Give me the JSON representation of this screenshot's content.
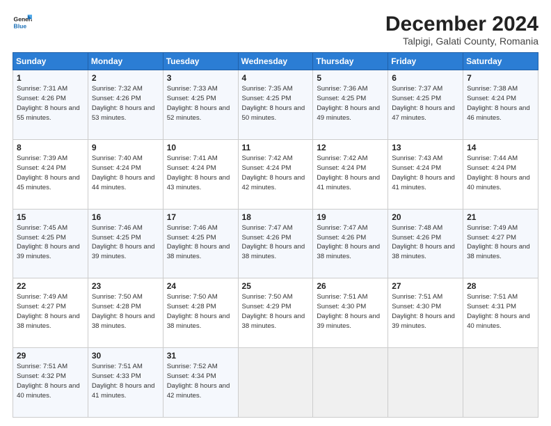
{
  "logo": {
    "line1": "General",
    "line2": "Blue"
  },
  "title": "December 2024",
  "subtitle": "Talpigi, Galati County, Romania",
  "header_days": [
    "Sunday",
    "Monday",
    "Tuesday",
    "Wednesday",
    "Thursday",
    "Friday",
    "Saturday"
  ],
  "weeks": [
    [
      {
        "day": "1",
        "sunrise": "Sunrise: 7:31 AM",
        "sunset": "Sunset: 4:26 PM",
        "daylight": "Daylight: 8 hours and 55 minutes."
      },
      {
        "day": "2",
        "sunrise": "Sunrise: 7:32 AM",
        "sunset": "Sunset: 4:26 PM",
        "daylight": "Daylight: 8 hours and 53 minutes."
      },
      {
        "day": "3",
        "sunrise": "Sunrise: 7:33 AM",
        "sunset": "Sunset: 4:25 PM",
        "daylight": "Daylight: 8 hours and 52 minutes."
      },
      {
        "day": "4",
        "sunrise": "Sunrise: 7:35 AM",
        "sunset": "Sunset: 4:25 PM",
        "daylight": "Daylight: 8 hours and 50 minutes."
      },
      {
        "day": "5",
        "sunrise": "Sunrise: 7:36 AM",
        "sunset": "Sunset: 4:25 PM",
        "daylight": "Daylight: 8 hours and 49 minutes."
      },
      {
        "day": "6",
        "sunrise": "Sunrise: 7:37 AM",
        "sunset": "Sunset: 4:25 PM",
        "daylight": "Daylight: 8 hours and 47 minutes."
      },
      {
        "day": "7",
        "sunrise": "Sunrise: 7:38 AM",
        "sunset": "Sunset: 4:24 PM",
        "daylight": "Daylight: 8 hours and 46 minutes."
      }
    ],
    [
      {
        "day": "8",
        "sunrise": "Sunrise: 7:39 AM",
        "sunset": "Sunset: 4:24 PM",
        "daylight": "Daylight: 8 hours and 45 minutes."
      },
      {
        "day": "9",
        "sunrise": "Sunrise: 7:40 AM",
        "sunset": "Sunset: 4:24 PM",
        "daylight": "Daylight: 8 hours and 44 minutes."
      },
      {
        "day": "10",
        "sunrise": "Sunrise: 7:41 AM",
        "sunset": "Sunset: 4:24 PM",
        "daylight": "Daylight: 8 hours and 43 minutes."
      },
      {
        "day": "11",
        "sunrise": "Sunrise: 7:42 AM",
        "sunset": "Sunset: 4:24 PM",
        "daylight": "Daylight: 8 hours and 42 minutes."
      },
      {
        "day": "12",
        "sunrise": "Sunrise: 7:42 AM",
        "sunset": "Sunset: 4:24 PM",
        "daylight": "Daylight: 8 hours and 41 minutes."
      },
      {
        "day": "13",
        "sunrise": "Sunrise: 7:43 AM",
        "sunset": "Sunset: 4:24 PM",
        "daylight": "Daylight: 8 hours and 41 minutes."
      },
      {
        "day": "14",
        "sunrise": "Sunrise: 7:44 AM",
        "sunset": "Sunset: 4:24 PM",
        "daylight": "Daylight: 8 hours and 40 minutes."
      }
    ],
    [
      {
        "day": "15",
        "sunrise": "Sunrise: 7:45 AM",
        "sunset": "Sunset: 4:25 PM",
        "daylight": "Daylight: 8 hours and 39 minutes."
      },
      {
        "day": "16",
        "sunrise": "Sunrise: 7:46 AM",
        "sunset": "Sunset: 4:25 PM",
        "daylight": "Daylight: 8 hours and 39 minutes."
      },
      {
        "day": "17",
        "sunrise": "Sunrise: 7:46 AM",
        "sunset": "Sunset: 4:25 PM",
        "daylight": "Daylight: 8 hours and 38 minutes."
      },
      {
        "day": "18",
        "sunrise": "Sunrise: 7:47 AM",
        "sunset": "Sunset: 4:26 PM",
        "daylight": "Daylight: 8 hours and 38 minutes."
      },
      {
        "day": "19",
        "sunrise": "Sunrise: 7:47 AM",
        "sunset": "Sunset: 4:26 PM",
        "daylight": "Daylight: 8 hours and 38 minutes."
      },
      {
        "day": "20",
        "sunrise": "Sunrise: 7:48 AM",
        "sunset": "Sunset: 4:26 PM",
        "daylight": "Daylight: 8 hours and 38 minutes."
      },
      {
        "day": "21",
        "sunrise": "Sunrise: 7:49 AM",
        "sunset": "Sunset: 4:27 PM",
        "daylight": "Daylight: 8 hours and 38 minutes."
      }
    ],
    [
      {
        "day": "22",
        "sunrise": "Sunrise: 7:49 AM",
        "sunset": "Sunset: 4:27 PM",
        "daylight": "Daylight: 8 hours and 38 minutes."
      },
      {
        "day": "23",
        "sunrise": "Sunrise: 7:50 AM",
        "sunset": "Sunset: 4:28 PM",
        "daylight": "Daylight: 8 hours and 38 minutes."
      },
      {
        "day": "24",
        "sunrise": "Sunrise: 7:50 AM",
        "sunset": "Sunset: 4:28 PM",
        "daylight": "Daylight: 8 hours and 38 minutes."
      },
      {
        "day": "25",
        "sunrise": "Sunrise: 7:50 AM",
        "sunset": "Sunset: 4:29 PM",
        "daylight": "Daylight: 8 hours and 38 minutes."
      },
      {
        "day": "26",
        "sunrise": "Sunrise: 7:51 AM",
        "sunset": "Sunset: 4:30 PM",
        "daylight": "Daylight: 8 hours and 39 minutes."
      },
      {
        "day": "27",
        "sunrise": "Sunrise: 7:51 AM",
        "sunset": "Sunset: 4:30 PM",
        "daylight": "Daylight: 8 hours and 39 minutes."
      },
      {
        "day": "28",
        "sunrise": "Sunrise: 7:51 AM",
        "sunset": "Sunset: 4:31 PM",
        "daylight": "Daylight: 8 hours and 40 minutes."
      }
    ],
    [
      {
        "day": "29",
        "sunrise": "Sunrise: 7:51 AM",
        "sunset": "Sunset: 4:32 PM",
        "daylight": "Daylight: 8 hours and 40 minutes."
      },
      {
        "day": "30",
        "sunrise": "Sunrise: 7:51 AM",
        "sunset": "Sunset: 4:33 PM",
        "daylight": "Daylight: 8 hours and 41 minutes."
      },
      {
        "day": "31",
        "sunrise": "Sunrise: 7:52 AM",
        "sunset": "Sunset: 4:34 PM",
        "daylight": "Daylight: 8 hours and 42 minutes."
      },
      null,
      null,
      null,
      null
    ]
  ]
}
